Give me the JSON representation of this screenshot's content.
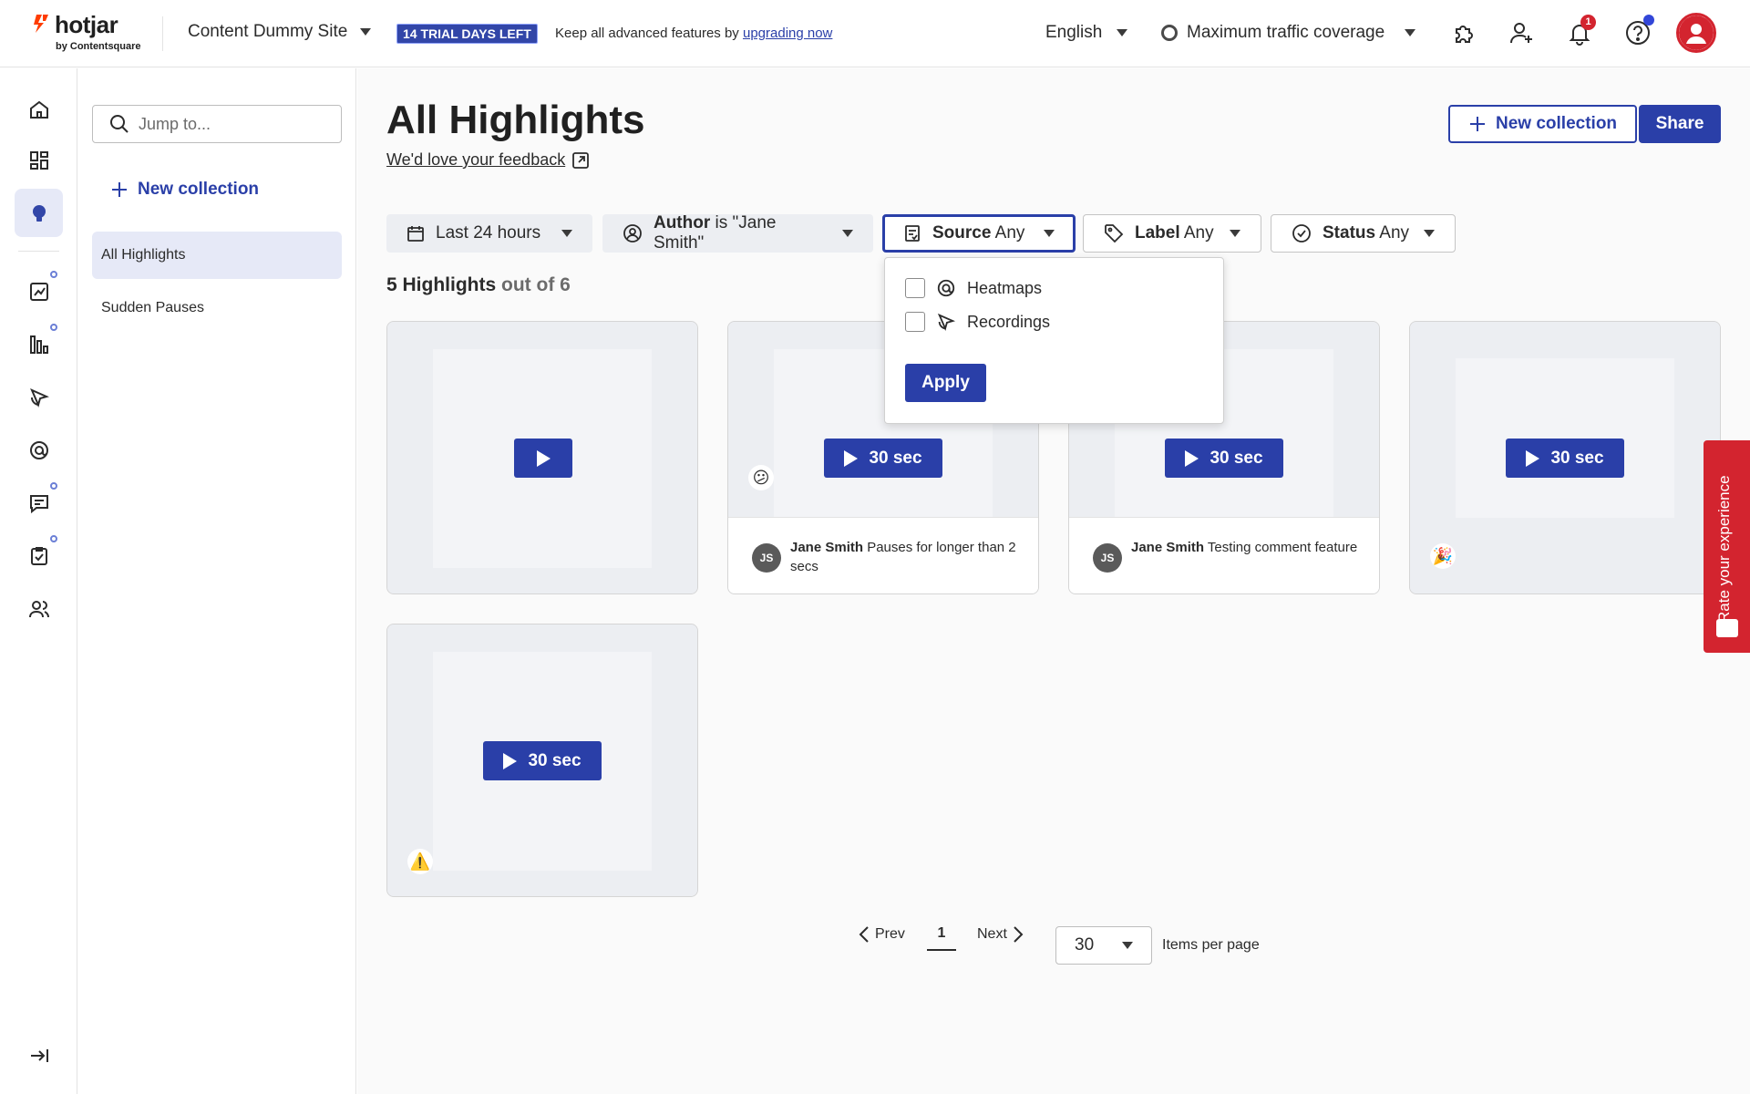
{
  "brand": {
    "name": "hotjar",
    "byline": "by Contentsquare"
  },
  "topbar": {
    "site": "Content Dummy Site",
    "trial_badge": "14 TRIAL DAYS LEFT",
    "trial_text": "Keep all advanced features by ",
    "trial_link": "upgrading now",
    "language": "English",
    "traffic": "Maximum traffic coverage",
    "notifications_count": "1"
  },
  "sidebar": {
    "search_placeholder": "Jump to...",
    "new_collection": "New collection",
    "items": [
      {
        "label": "All Highlights"
      },
      {
        "label": "Sudden Pauses"
      }
    ]
  },
  "main": {
    "title": "All Highlights",
    "feedback": "We'd love your feedback",
    "new_collection_button": "New collection",
    "share_button": "Share",
    "filters": {
      "date": "Last 24 hours",
      "author_prefix": "Author",
      "author_value": " is \"Jane Smith\"",
      "source_prefix": "Source",
      "source_value": " Any",
      "label_prefix": "Label",
      "label_value": " Any",
      "status_prefix": "Status",
      "status_value": " Any"
    },
    "count_strong": "5 Highlights",
    "count_muted": " out of 6",
    "cards": [
      {
        "duration": "",
        "emoji": "",
        "author": "",
        "comment": ""
      },
      {
        "duration": "30 sec",
        "emoji": "😕",
        "initials": "JS",
        "author": "Jane Smith",
        "comment": " Pauses for longer than 2 secs"
      },
      {
        "duration": "30 sec",
        "emoji": "",
        "initials": "JS",
        "author": "Jane Smith",
        "comment": " Testing comment feature"
      },
      {
        "duration": "30 sec",
        "emoji": "🎉",
        "author": "",
        "comment": ""
      },
      {
        "duration": "30 sec",
        "emoji": "⚠️",
        "author": "",
        "comment": ""
      }
    ],
    "source_dropdown": {
      "options": [
        {
          "label": "Heatmaps"
        },
        {
          "label": "Recordings"
        }
      ],
      "apply": "Apply"
    },
    "pagination": {
      "prev": "Prev",
      "page": "1",
      "next": "Next",
      "per_page": "30",
      "per_page_label": "Items per page"
    }
  },
  "rate_tab": "Rate your experience",
  "colors": {
    "primary": "#2a3fa8",
    "brand_red": "#d3242f",
    "active_bg": "#e6e9f7"
  }
}
